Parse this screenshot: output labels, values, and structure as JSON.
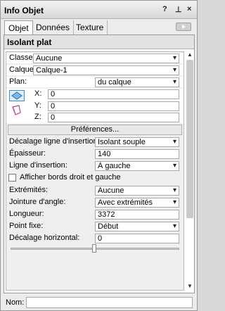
{
  "window": {
    "title": "Info Objet",
    "help": "?",
    "pin": "⊥",
    "close": "×"
  },
  "tabs": [
    "Objet",
    "Données",
    "Texture"
  ],
  "object_type": "Isolant plat",
  "fields": {
    "classe": {
      "label": "Classe:",
      "value": "Aucune"
    },
    "calque": {
      "label": "Calque:",
      "value": "Calque-1"
    },
    "plan": {
      "label": "Plan:",
      "value": "du calque"
    },
    "x": {
      "label": "X:",
      "value": "0"
    },
    "y": {
      "label": "Y:",
      "value": "0"
    },
    "z": {
      "label": "Z:",
      "value": "0"
    },
    "preferences": "Préférences...",
    "decalage_ligne": {
      "label": "Décalage ligne d'insertion:",
      "value": "Isolant souple"
    },
    "epaisseur": {
      "label": "Épaisseur:",
      "value": "140"
    },
    "ligne_insertion": {
      "label": "Ligne d'insertion:",
      "value": "À gauche"
    },
    "afficher_bords": {
      "label": "Afficher bords droit et gauche"
    },
    "extremites": {
      "label": "Extrémités:",
      "value": "Aucune"
    },
    "jointure": {
      "label": "Jointure d'angle:",
      "value": "Avec extrémités"
    },
    "longueur": {
      "label": "Longueur:",
      "value": "3372"
    },
    "point_fixe": {
      "label": "Point fixe:",
      "value": "Début"
    },
    "decalage_horizontal": {
      "label": "Décalage horizontal:",
      "value": "0"
    }
  },
  "footer": {
    "nom_label": "Nom:",
    "nom_value": ""
  },
  "colors": {
    "accent": "#3c8fd6",
    "icon_pink": "#c43b93"
  }
}
